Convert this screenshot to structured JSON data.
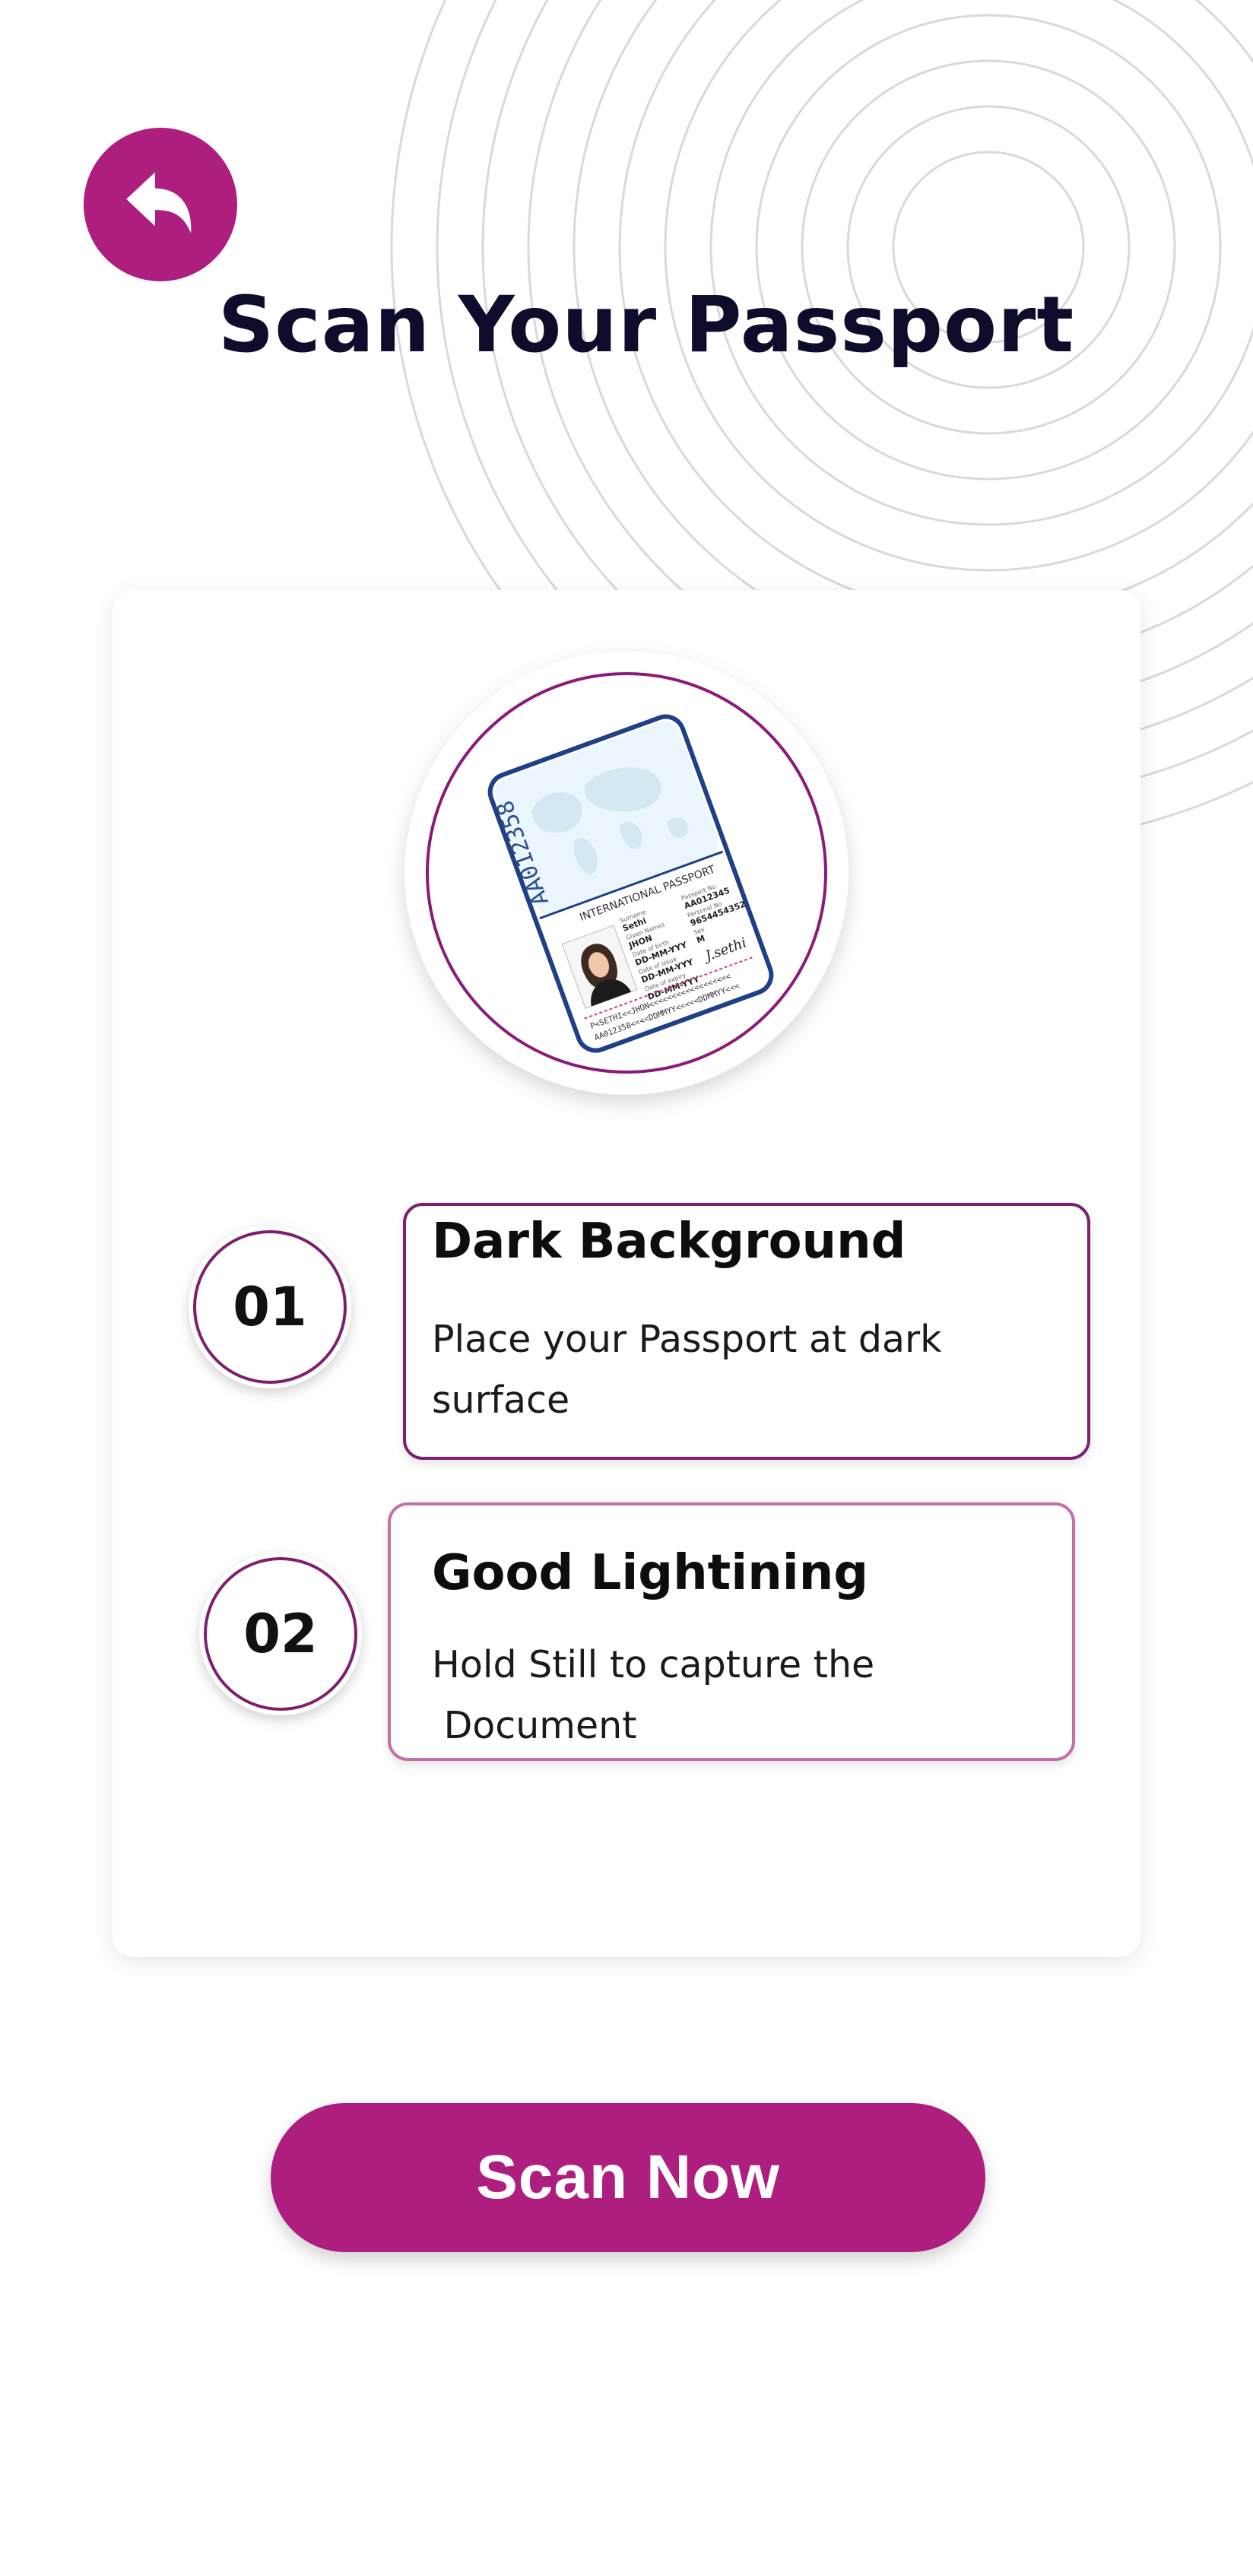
{
  "header": {
    "back_icon": "back-arrow-icon",
    "title": "Scan Your Passport"
  },
  "passport_illustration": {
    "icon": "passport-icon",
    "document_number": "AA012358",
    "label": "INTERNATIONAL PASSPORT",
    "fields": {
      "surname_label": "Surname",
      "surname": "Sethi",
      "given_names_label": "Given Names",
      "given_names": "JHON",
      "dob_label": "Date of birth",
      "dob": "DD-MM-YYY",
      "issue_label": "Date of issue",
      "issue": "DD-MM-YYY",
      "expiry_label": "Date of expiry",
      "expiry": "DD-MM-YYY",
      "passport_no_label": "Passport No",
      "passport_no": "AA012345",
      "personal_no_label": "Personal No",
      "personal_no": "9654454352",
      "sex_label": "Sex",
      "sex": "M",
      "signature": "J.sethi"
    },
    "mrz_line_1": "P<SETHI<<JHON<<<<<<<<<<<<<<<<<<",
    "mrz_line_2": "AA012358<<<<DDMMYY<<<<<DDMMYY<<<"
  },
  "steps": [
    {
      "number": "01",
      "title": "Dark Background",
      "description": "Place your Passport at dark\nsurface"
    },
    {
      "number": "02",
      "title": "Good Lightining",
      "description": "Hold Still to capture the\n Document"
    }
  ],
  "scan_button": {
    "label": "Scan Now"
  },
  "colors": {
    "accent": "#ad1e7f",
    "ring": "#7d1f6e",
    "title": "#0d0d2b",
    "passport_border": "#1f3f86"
  }
}
